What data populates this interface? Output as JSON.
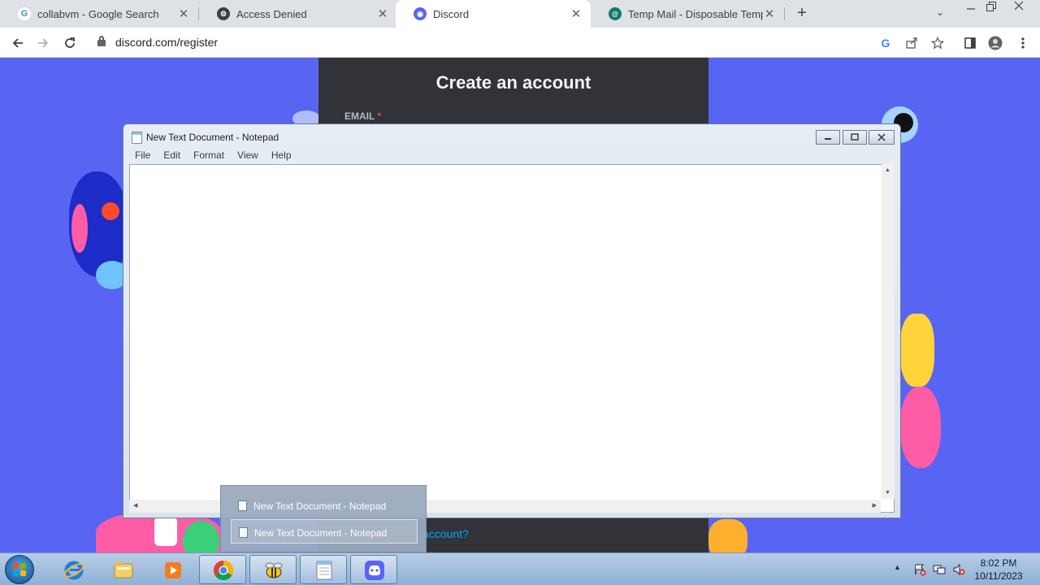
{
  "browser": {
    "tabs": [
      {
        "title": "collabvm - Google Search",
        "icon": "google-icon",
        "active": false
      },
      {
        "title": "Access Denied",
        "icon": "access-denied-icon",
        "active": false
      },
      {
        "title": "Discord",
        "icon": "discord-icon",
        "active": true
      },
      {
        "title": "Temp Mail - Disposable Tempora",
        "icon": "temp-mail-icon",
        "active": false
      }
    ],
    "new_tab_symbol": "+",
    "tab_search_symbol": "⌄",
    "url": "discord.com/register",
    "toolbar_icons": [
      "google-lens-icon",
      "share-icon",
      "bookmark-star-icon",
      "side-panel-icon",
      "profile-icon",
      "menu-icon"
    ],
    "window_controls": [
      "minimize",
      "restore",
      "close"
    ]
  },
  "discord": {
    "title": "Create an account",
    "email_label": "EMAIL",
    "required_mark": "*",
    "login_link": "account?",
    "background_color": "#5865f2",
    "card_color": "#313338"
  },
  "notepad": {
    "title": "New Text Document - Notepad",
    "menu": [
      "File",
      "Edit",
      "Format",
      "View",
      "Help"
    ],
    "content": ""
  },
  "taskbar_thumbnails": {
    "items": [
      {
        "label": "New Text Document - Notepad",
        "selected": false
      },
      {
        "label": "New Text Document - Notepad",
        "selected": true
      }
    ]
  },
  "taskbar": {
    "apps": [
      "internet-explorer-icon",
      "file-explorer-icon",
      "media-player-icon",
      "chrome-icon",
      "bee-app-icon",
      "notepad-icon",
      "discord-icon"
    ],
    "clock_time": "8:02 PM",
    "clock_date": "10/11/2023"
  }
}
